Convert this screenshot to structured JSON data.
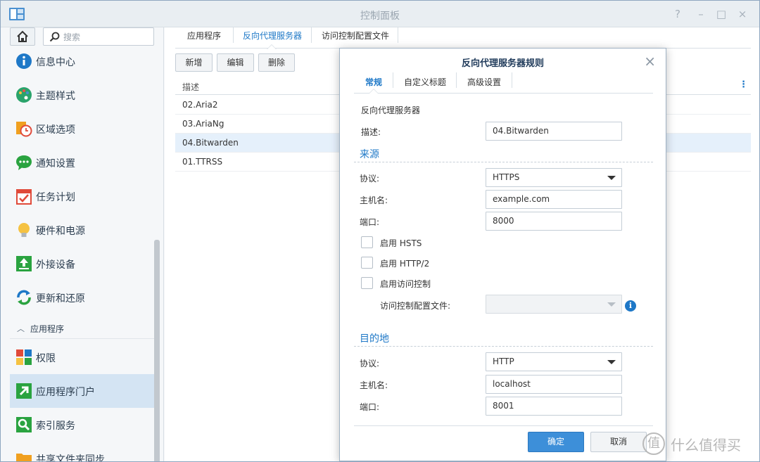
{
  "window": {
    "title": "控制面板",
    "controls": [
      "?",
      "–",
      "□",
      "×"
    ]
  },
  "sidebar": {
    "search_placeholder": "搜索",
    "items": [
      {
        "label": "信息中心",
        "icon": "info-icon"
      },
      {
        "label": "主题样式",
        "icon": "palette-icon"
      },
      {
        "label": "区域选项",
        "icon": "region-clock-icon"
      },
      {
        "label": "通知设置",
        "icon": "chat-bubble-icon"
      },
      {
        "label": "任务计划",
        "icon": "calendar-check-icon"
      },
      {
        "label": "硬件和电源",
        "icon": "lightbulb-icon"
      },
      {
        "label": "外接设备",
        "icon": "upload-device-icon"
      },
      {
        "label": "更新和还原",
        "icon": "refresh-icon"
      }
    ],
    "section": "应用程序",
    "app_items": [
      {
        "label": "权限",
        "icon": "permission-grid-icon"
      },
      {
        "label": "应用程序门户",
        "icon": "app-portal-arrow-icon",
        "active": true
      },
      {
        "label": "索引服务",
        "icon": "search-index-icon"
      },
      {
        "label": "共享文件夹同步",
        "icon": "folder-sync-icon"
      }
    ]
  },
  "main": {
    "tabs": [
      "应用程序",
      "反向代理服务器",
      "访问控制配置文件"
    ],
    "active_tab": "反向代理服务器",
    "toolbar": {
      "add": "新增",
      "edit": "编辑",
      "delete": "删除"
    },
    "grid": {
      "header": "描述",
      "rows": [
        "02.Aria2",
        "03.AriaNg",
        "04.Bitwarden",
        "01.TTRSS"
      ],
      "selected": "04.Bitwarden"
    }
  },
  "dialog": {
    "title": "反向代理服务器规则",
    "tabs": [
      "常规",
      "自定义标题",
      "高级设置"
    ],
    "active_tab": "常规",
    "group_label": "反向代理服务器",
    "description_label": "描述:",
    "description_value": "04.Bitwarden",
    "source": {
      "title": "来源",
      "protocol_label": "协议:",
      "protocol_value": "HTTPS",
      "hostname_label": "主机名:",
      "hostname_value": "example.com",
      "port_label": "端口:",
      "port_value": "8000",
      "hsts_label": "启用 HSTS",
      "http2_label": "启用 HTTP/2",
      "access_control_label": "启用访问控制",
      "access_profile_label": "访问控制配置文件:",
      "access_profile_value": ""
    },
    "destination": {
      "title": "目的地",
      "protocol_label": "协议:",
      "protocol_value": "HTTP",
      "hostname_label": "主机名:",
      "hostname_value": "localhost",
      "port_label": "端口:",
      "port_value": "8001"
    },
    "ok": "确定",
    "cancel": "取消"
  },
  "watermark": {
    "logo": "值",
    "text": "什么值得买"
  },
  "colors": {
    "accent": "#1e78c7",
    "selected_row": "#e5f0fb",
    "active_sidebar": "#d4e4f3",
    "ok_button": "#3d8fd9"
  }
}
